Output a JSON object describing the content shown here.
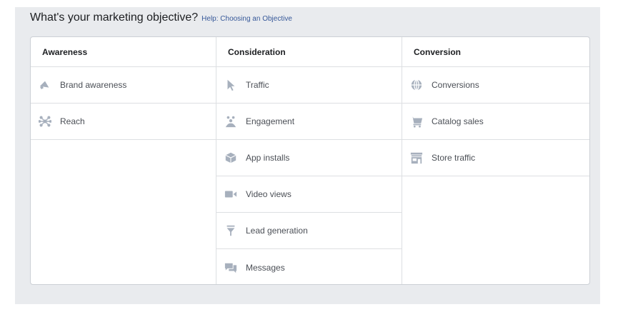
{
  "header": {
    "title": "What's your marketing objective?",
    "help_link": "Help: Choosing an Objective"
  },
  "columns": [
    {
      "title": "Awareness",
      "items": [
        {
          "label": "Brand awareness",
          "icon": "megaphone-icon"
        },
        {
          "label": "Reach",
          "icon": "reach-icon"
        }
      ]
    },
    {
      "title": "Consideration",
      "items": [
        {
          "label": "Traffic",
          "icon": "cursor-icon"
        },
        {
          "label": "Engagement",
          "icon": "people-icon"
        },
        {
          "label": "App installs",
          "icon": "box-icon"
        },
        {
          "label": "Video views",
          "icon": "video-camera-icon"
        },
        {
          "label": "Lead generation",
          "icon": "funnel-icon"
        },
        {
          "label": "Messages",
          "icon": "chat-bubbles-icon"
        }
      ]
    },
    {
      "title": "Conversion",
      "items": [
        {
          "label": "Conversions",
          "icon": "globe-icon"
        },
        {
          "label": "Catalog sales",
          "icon": "shopping-cart-icon"
        },
        {
          "label": "Store traffic",
          "icon": "store-icon"
        }
      ]
    }
  ],
  "colors": {
    "icon": "#a7b0bd",
    "link": "#365899",
    "border": "#dddfe2",
    "panel": "#e9ebee"
  }
}
